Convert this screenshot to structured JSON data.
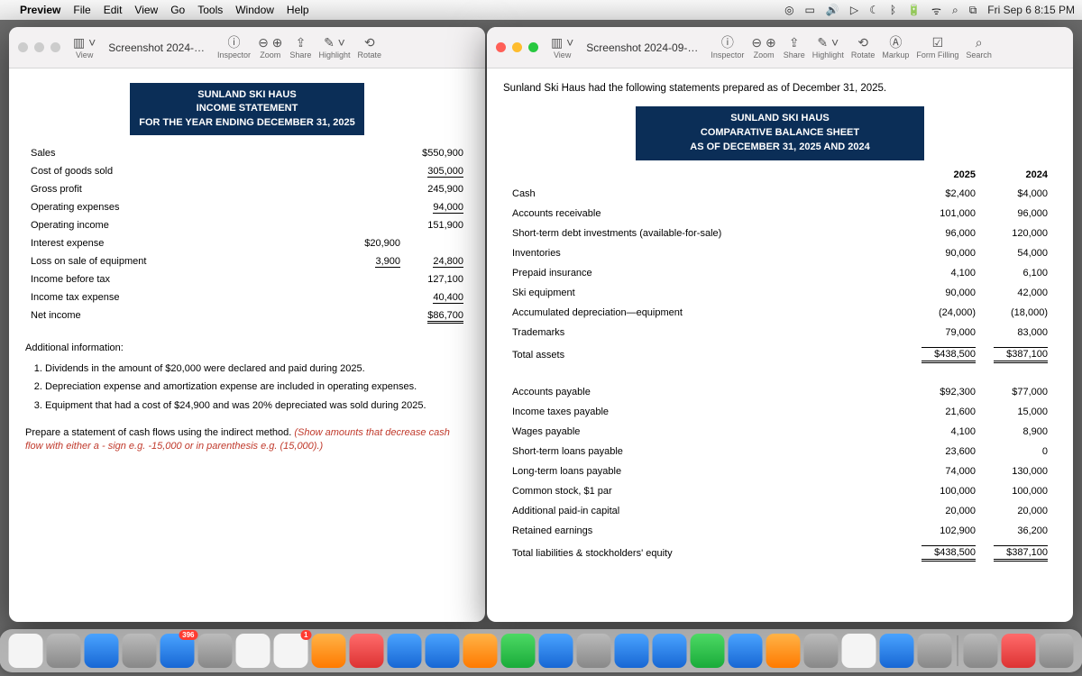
{
  "menubar": {
    "app": "Preview",
    "items": [
      "File",
      "Edit",
      "View",
      "Go",
      "Tools",
      "Window",
      "Help"
    ],
    "clock": "Fri Sep 6 8:15 PM"
  },
  "left_window": {
    "title": "Screenshot 2024-…",
    "toolbar": [
      "View",
      "Inspector",
      "Zoom",
      "Share",
      "Highlight",
      "Rotate"
    ]
  },
  "right_window": {
    "title": "Screenshot 2024-09-…",
    "toolbar": [
      "View",
      "Inspector",
      "Zoom",
      "Share",
      "Highlight",
      "Rotate",
      "Markup",
      "Form Filling",
      "Search"
    ]
  },
  "income_statement": {
    "header1": "SUNLAND SKI HAUS",
    "header2": "INCOME STATEMENT",
    "header3": "FOR THE YEAR ENDING DECEMBER 31, 2025",
    "rows": {
      "sales_l": "Sales",
      "sales_v": "$550,900",
      "cogs_l": "Cost of goods sold",
      "cogs_v": "305,000",
      "gp_l": "Gross profit",
      "gp_v": "245,900",
      "opex_l": "Operating expenses",
      "opex_v": "94,000",
      "opinc_l": "Operating income",
      "opinc_v": "151,900",
      "int_l": "Interest expense",
      "int_v": "$20,900",
      "loss_l": "Loss on sale of equipment",
      "loss_v1": "3,900",
      "loss_v2": "24,800",
      "ibt_l": "Income before tax",
      "ibt_v": "127,100",
      "tax_l": "Income tax expense",
      "tax_v": "40,400",
      "ni_l": "Net income",
      "ni_v": "$86,700"
    }
  },
  "additional": {
    "title": "Additional information:",
    "i1": "Dividends in the amount of $20,000 were declared and paid during 2025.",
    "i2": "Depreciation expense and amortization expense are included in operating expenses.",
    "i3": "Equipment that had a cost of $24,900 and was 20% depreciated was sold during 2025."
  },
  "instruction": {
    "p1": "Prepare a statement of cash flows using the indirect method. ",
    "p2": "(Show amounts that decrease cash flow with either a - sign e.g. -15,000 or in parenthesis e.g. (15,000).)"
  },
  "bs_caption": "Sunland Ski Haus had the following statements prepared as of December 31, 2025.",
  "bs_header": {
    "h1": "SUNLAND SKI HAUS",
    "h2": "COMPARATIVE BALANCE SHEET",
    "h3": "AS OF DECEMBER 31, 2025 AND 2024"
  },
  "bs_cols": {
    "y1": "2025",
    "y2": "2024"
  },
  "bs_assets": {
    "cash_l": "Cash",
    "cash_1": "$2,400",
    "cash_2": "$4,000",
    "ar_l": "Accounts receivable",
    "ar_1": "101,000",
    "ar_2": "96,000",
    "st_l": "Short-term debt investments (available-for-sale)",
    "st_1": "96,000",
    "st_2": "120,000",
    "inv_l": "Inventories",
    "inv_1": "90,000",
    "inv_2": "54,000",
    "pre_l": "Prepaid insurance",
    "pre_1": "4,100",
    "pre_2": "6,100",
    "ski_l": "Ski equipment",
    "ski_1": "90,000",
    "ski_2": "42,000",
    "ad_l": "Accumulated depreciation—equipment",
    "ad_1": "(24,000)",
    "ad_2": "(18,000)",
    "tm_l": "Trademarks",
    "tm_1": "79,000",
    "tm_2": "83,000",
    "tot_l": "Total assets",
    "tot_1": "$438,500",
    "tot_2": "$387,100"
  },
  "bs_liab": {
    "ap_l": "Accounts payable",
    "ap_1": "$92,300",
    "ap_2": "$77,000",
    "it_l": "Income taxes payable",
    "it_1": "21,600",
    "it_2": "15,000",
    "wp_l": "Wages payable",
    "wp_1": "4,100",
    "wp_2": "8,900",
    "stl_l": "Short-term loans payable",
    "stl_1": "23,600",
    "stl_2": "0",
    "ltl_l": "Long-term loans payable",
    "ltl_1": "74,000",
    "ltl_2": "130,000",
    "cs_l": "Common stock, $1 par",
    "cs_1": "100,000",
    "cs_2": "100,000",
    "apic_l": "Additional paid-in capital",
    "apic_1": "20,000",
    "apic_2": "20,000",
    "re_l": "Retained earnings",
    "re_1": "102,900",
    "re_2": "36,200",
    "tot_l": "Total liabilities & stockholders' equity",
    "tot_1": "$438,500",
    "tot_2": "$387,100"
  }
}
